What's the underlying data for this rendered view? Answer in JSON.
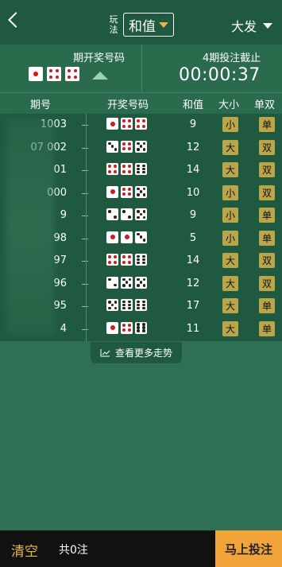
{
  "header": {
    "mode_small_label": "玩法",
    "mode_value": "和值",
    "brand": "大发"
  },
  "info": {
    "prev_label": "期开奖号码",
    "prev_dice": [
      1,
      4,
      4
    ],
    "next_label": "4期投注截止",
    "countdown": "00:00:37"
  },
  "table": {
    "headers": [
      "期号",
      "开奖号码",
      "和值",
      "大小",
      "单双"
    ],
    "rows": [
      {
        "issue": "1003",
        "dice": [
          1,
          4,
          4
        ],
        "sum": "9",
        "size": "小",
        "parity": "单"
      },
      {
        "issue": "07  002",
        "dice": [
          3,
          4,
          5
        ],
        "sum": "12",
        "size": "大",
        "parity": "双"
      },
      {
        "issue": "01",
        "dice": [
          4,
          4,
          6
        ],
        "sum": "14",
        "size": "大",
        "parity": "双"
      },
      {
        "issue": "000",
        "dice": [
          1,
          4,
          5
        ],
        "sum": "10",
        "size": "小",
        "parity": "双"
      },
      {
        "issue": "9",
        "dice": [
          2,
          2,
          5
        ],
        "sum": "9",
        "size": "小",
        "parity": "单"
      },
      {
        "issue": "98",
        "dice": [
          1,
          1,
          3
        ],
        "sum": "5",
        "size": "小",
        "parity": "单"
      },
      {
        "issue": "97",
        "dice": [
          4,
          4,
          6
        ],
        "sum": "14",
        "size": "大",
        "parity": "双"
      },
      {
        "issue": "96",
        "dice": [
          2,
          5,
          5
        ],
        "sum": "12",
        "size": "大",
        "parity": "双"
      },
      {
        "issue": "95",
        "dice": [
          5,
          6,
          6
        ],
        "sum": "17",
        "size": "大",
        "parity": "单"
      },
      {
        "issue": "4",
        "dice": [
          1,
          4,
          6
        ],
        "sum": "11",
        "size": "大",
        "parity": "单"
      }
    ]
  },
  "more_trend_label": "查看更多走势",
  "footer": {
    "clear_label": "清空",
    "count_label": "共0注",
    "bet_label": "马上投注"
  }
}
